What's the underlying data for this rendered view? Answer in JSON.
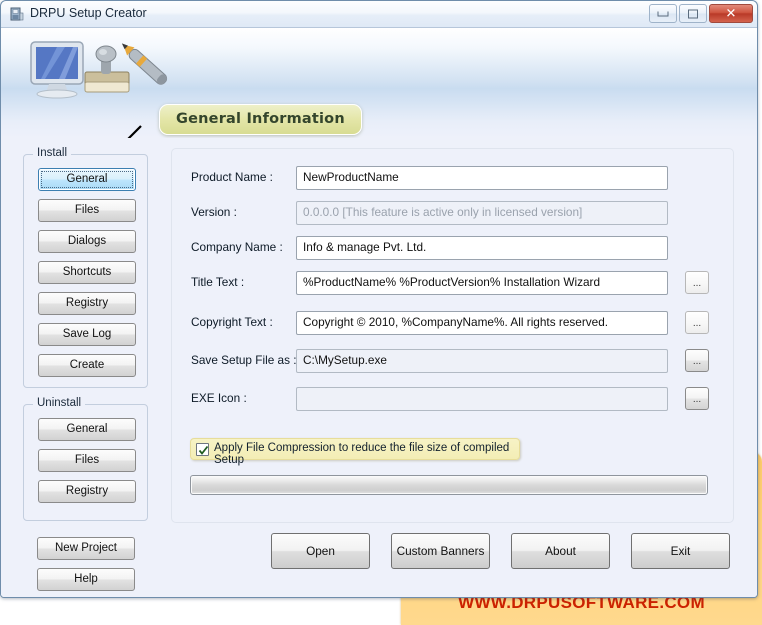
{
  "window": {
    "title": "DRPU Setup Creator",
    "icon": "setup-creator-icon",
    "minimize_label": "",
    "maximize_label": "",
    "close_label": "✕"
  },
  "header": {
    "banner_title": "General Information",
    "art_icon": "monitor-stamp-pen-illustration",
    "arrow_icon": "pointer-arrow-icon"
  },
  "sidebar": {
    "install": {
      "legend": "Install",
      "items": [
        {
          "label": "General",
          "focused": true
        },
        {
          "label": "Files",
          "focused": false
        },
        {
          "label": "Dialogs",
          "focused": false
        },
        {
          "label": "Shortcuts",
          "focused": false
        },
        {
          "label": "Registry",
          "focused": false
        },
        {
          "label": "Save Log",
          "focused": false
        },
        {
          "label": "Create",
          "focused": false
        }
      ]
    },
    "uninstall": {
      "legend": "Uninstall",
      "items": [
        {
          "label": "General"
        },
        {
          "label": "Files"
        },
        {
          "label": "Registry"
        }
      ]
    },
    "extra": [
      {
        "label": "New Project"
      },
      {
        "label": "Help"
      }
    ]
  },
  "form": {
    "fields": [
      {
        "label": "Product Name :",
        "value": "NewProductName",
        "placeholder": "",
        "state": "normal",
        "browse": false
      },
      {
        "label": "Version :",
        "value": "0.0.0.0 [This feature is active only in licensed version]",
        "placeholder": "0.0.0.0 [This feature is active only in licensed version]",
        "state": "disabled",
        "browse": false
      },
      {
        "label": "Company Name :",
        "value": "Info & manage Pvt. Ltd.",
        "placeholder": "",
        "state": "normal",
        "browse": false
      },
      {
        "label": "Title Text :",
        "value": "%ProductName% %ProductVersion% Installation Wizard",
        "placeholder": "",
        "state": "normal",
        "browse": true,
        "browse_label": "...",
        "browse_style": "flat"
      },
      {
        "label": "Copyright Text :",
        "value": "Copyright © 2010, %CompanyName%. All rights reserved.",
        "placeholder": "",
        "state": "normal",
        "browse": true,
        "browse_label": "...",
        "browse_style": "flat"
      },
      {
        "label": "Save Setup File as :",
        "value": "C:\\MySetup.exe",
        "placeholder": "",
        "state": "readonly",
        "browse": true,
        "browse_label": "...",
        "browse_style": "raised"
      },
      {
        "label": "EXE Icon :",
        "value": "",
        "placeholder": "",
        "state": "readonly",
        "browse": true,
        "browse_label": "...",
        "browse_style": "raised"
      }
    ],
    "compression": {
      "label": "Apply File Compression to reduce the file size of compiled Setup",
      "checked": true
    },
    "progress": {
      "value": 0
    }
  },
  "footer": {
    "buttons": [
      {
        "label": "Open"
      },
      {
        "label": "Custom Banners"
      },
      {
        "label": "About"
      },
      {
        "label": "Exit"
      }
    ]
  },
  "watermark": {
    "text": "WWW.DRPUSOFTWARE.COM",
    "bg_color": "#ffd17a",
    "text_color": "#cc2200"
  }
}
